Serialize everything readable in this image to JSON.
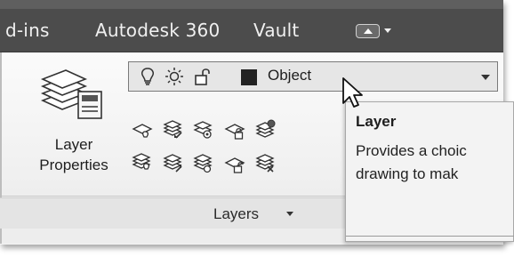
{
  "ribbon": {
    "tabs": [
      {
        "label": "d-ins"
      },
      {
        "label": "Autodesk 360"
      },
      {
        "label": "Vault"
      }
    ]
  },
  "layers_panel": {
    "layer_properties_label_line1": "Layer",
    "layer_properties_label_line2": "Properties",
    "layer_combo": {
      "value": "Object",
      "state_icons": [
        "lightbulb-icon",
        "sun-icon",
        "unlock-icon"
      ],
      "swatch_color": "#222222"
    },
    "title": "Layers"
  },
  "tooltip": {
    "title": "Layer",
    "line1": "Provides a choic",
    "line2": "drawing to mak"
  }
}
